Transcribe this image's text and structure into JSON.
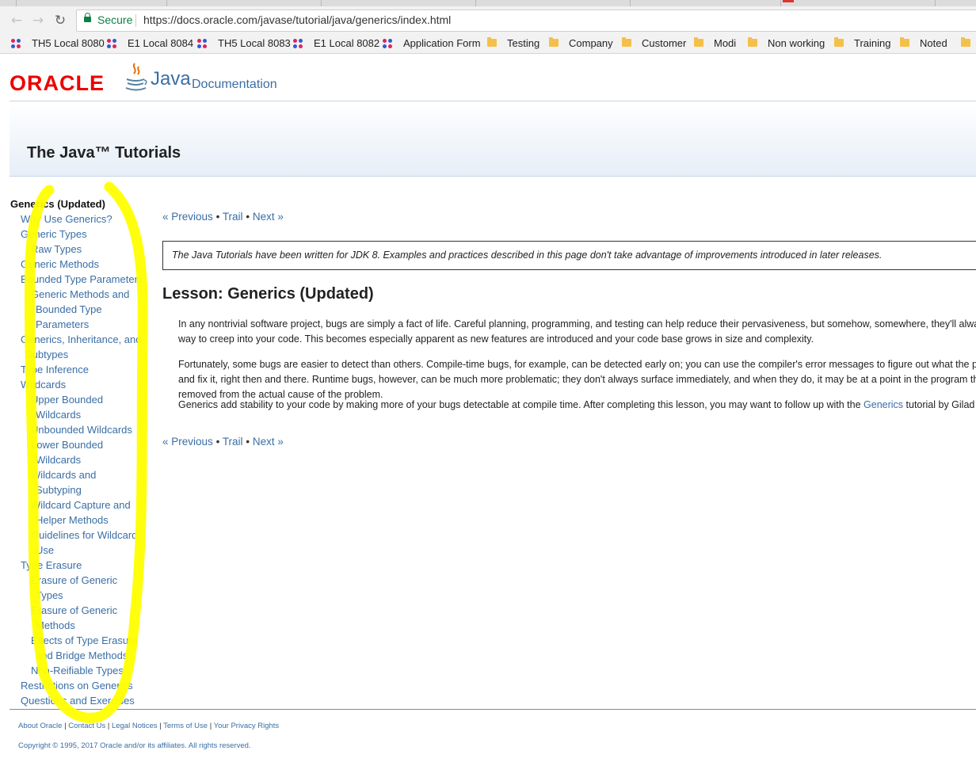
{
  "browser": {
    "secure_label": "Secure",
    "url": "https://docs.oracle.com/javase/tutorial/java/generics/index.html",
    "bookmarks": [
      {
        "label": "TH5 Local 8080",
        "icon": "app-dots-icon"
      },
      {
        "label": "E1 Local 8084",
        "icon": "app-dots-icon"
      },
      {
        "label": "TH5 Local 8083",
        "icon": "app-dots-icon"
      },
      {
        "label": "E1 Local 8082",
        "icon": "app-dots-icon"
      },
      {
        "label": "Application Form",
        "icon": "app-dots-icon"
      },
      {
        "label": "Testing",
        "icon": "folder-icon"
      },
      {
        "label": "Company",
        "icon": "folder-icon"
      },
      {
        "label": "Customer",
        "icon": "folder-icon"
      },
      {
        "label": "Modi",
        "icon": "folder-icon"
      },
      {
        "label": "Non working",
        "icon": "folder-icon"
      },
      {
        "label": "Training",
        "icon": "folder-icon"
      },
      {
        "label": "Noted",
        "icon": "folder-icon"
      }
    ]
  },
  "header": {
    "oracle_logo": "ORACLE",
    "java_logo": "Java",
    "documentation": "Documentation",
    "banner_title": "The Java™ Tutorials"
  },
  "sidebar": {
    "items": [
      {
        "label": "Generics (Updated)",
        "current": true
      },
      {
        "label": "Why Use Generics?"
      },
      {
        "label": "Generic Types"
      },
      {
        "label": "Raw Types"
      },
      {
        "label": "Generic Methods"
      },
      {
        "label": "Bounded Type Parameters"
      },
      {
        "label": "Generic Methods and"
      },
      {
        "label": "Bounded Type"
      },
      {
        "label": "Parameters"
      },
      {
        "label": "Generics, Inheritance, and"
      },
      {
        "label": "Subtypes"
      },
      {
        "label": "Type Inference"
      },
      {
        "label": "Wildcards"
      },
      {
        "label": "Upper Bounded"
      },
      {
        "label": "Wildcards"
      },
      {
        "label": "Unbounded Wildcards"
      },
      {
        "label": "Lower Bounded"
      },
      {
        "label": "Wildcards"
      },
      {
        "label": "Wildcards and"
      },
      {
        "label": "Subtyping"
      },
      {
        "label": "Wildcard Capture and"
      },
      {
        "label": "Helper Methods"
      },
      {
        "label": "Guidelines for Wildcard"
      },
      {
        "label": "Use"
      },
      {
        "label": "Type Erasure"
      },
      {
        "label": "Erasure of Generic"
      },
      {
        "label": "Types"
      },
      {
        "label": "Erasure of Generic"
      },
      {
        "label": "Methods"
      },
      {
        "label": "Effects of Type Erasure"
      },
      {
        "label": "and Bridge Methods"
      },
      {
        "label": "Non-Reifiable Types"
      },
      {
        "label": "Restrictions on Generics"
      },
      {
        "label": "Questions and Exercises"
      }
    ]
  },
  "pager": {
    "previous": "« Previous",
    "sep": "•",
    "trail": "Trail",
    "next": "Next »"
  },
  "main": {
    "notice": "The Java Tutorials have been written for JDK 8. Examples and practices described in this page don't take advantage of improvements introduced in later releases.",
    "lesson_title": "Lesson: Generics (Updated)",
    "para1": "In any nontrivial software project, bugs are simply a fact of life. Careful planning, programming, and testing can help reduce their pervasiveness, but somehow, somewhere, they'll always find a way to creep into your code. This becomes especially apparent as new features are introduced and your code base grows in size and complexity.",
    "para2": "Fortunately, some bugs are easier to detect than others. Compile-time bugs, for example, can be detected early on; you can use the compiler's error messages to figure out what the problem is and fix it, right then and there. Runtime bugs, however, can be much more problematic; they don't always surface immediately, and when they do, it may be at a point in the program that is far removed from the actual cause of the problem.",
    "para3_before": "Generics add stability to your code by making more of your bugs detectable at compile time. After completing this lesson, you may want to follow up with the ",
    "para3_link": "Generics",
    "para3_after": " tutorial by Gilad Bracha."
  },
  "footer": {
    "links": [
      "About Oracle",
      "Contact Us",
      "Legal Notices",
      "Terms of Use",
      "Your Privacy Rights"
    ],
    "sep": "|",
    "copyright": "Copyright © 1995, 2017 Oracle and/or its affiliates. All rights reserved."
  },
  "colors": {
    "link": "#3a6ea5",
    "oracle_red": "#ee0000",
    "highlight": "#ffff00"
  }
}
